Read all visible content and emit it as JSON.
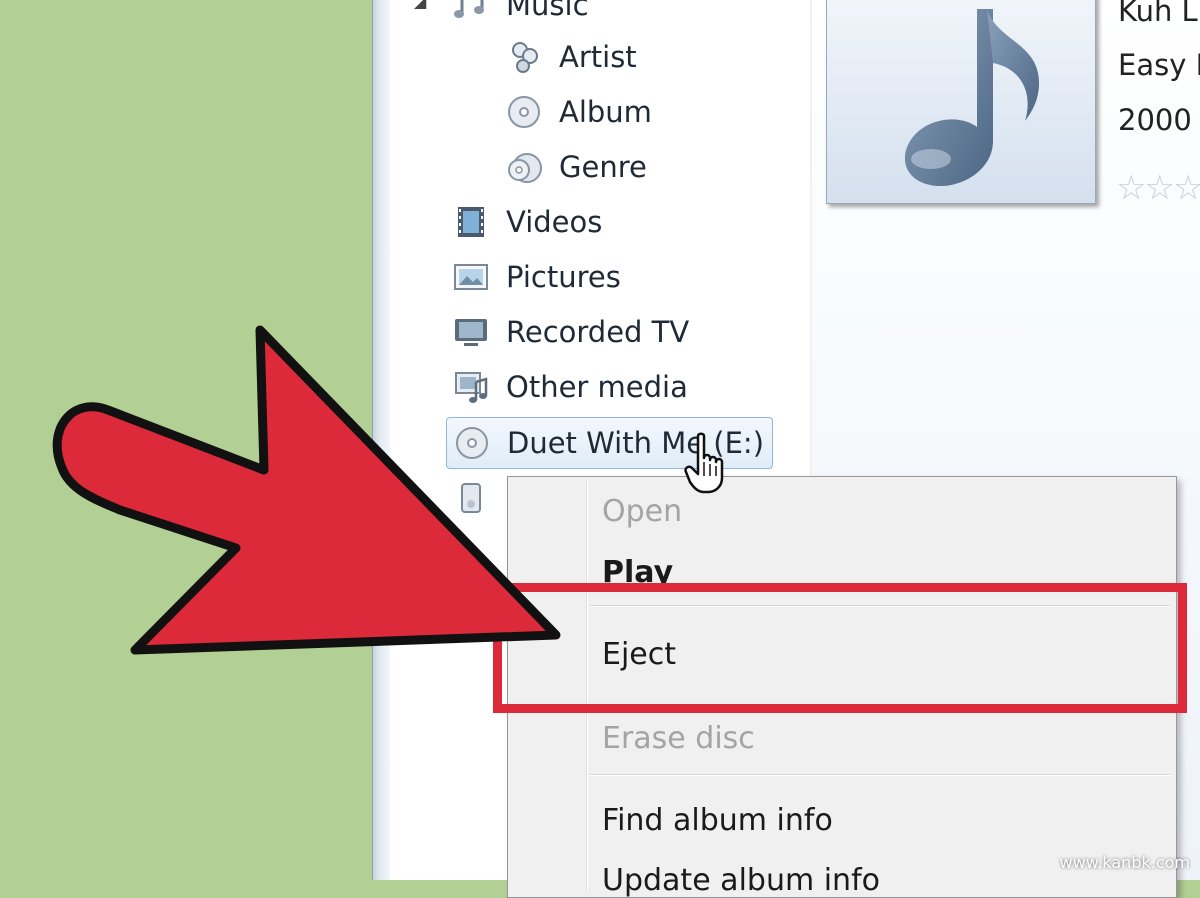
{
  "nav": {
    "music": "Music",
    "artist": "Artist",
    "album": "Album",
    "genre": "Genre",
    "videos": "Videos",
    "pictures": "Pictures",
    "recorded_tv": "Recorded TV",
    "other_media": "Other media",
    "disc": "Duet With Me (E:)"
  },
  "details": {
    "line1": "Kuh L",
    "line2": "Easy L",
    "line3": "2000",
    "rating_stars": "☆☆☆"
  },
  "context_menu": {
    "open": "Open",
    "play": "Play",
    "eject": "Eject",
    "erase": "Erase disc",
    "find_info": "Find album info",
    "update_info": "Update album info"
  },
  "watermark": "www.kanbk.com",
  "colors": {
    "highlight_red": "#dc2a3a",
    "background_green": "#b2d094",
    "selection_blue": "#8fb6e0"
  }
}
